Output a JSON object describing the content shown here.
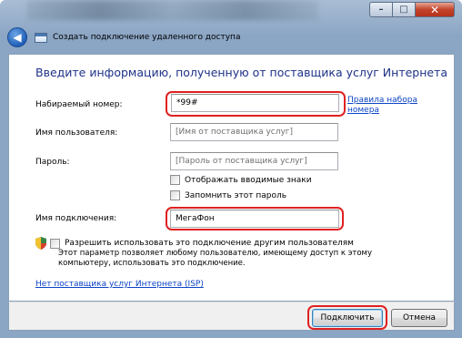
{
  "window": {
    "title": "Создать подключение удаленного доступа",
    "minimize_glyph": "–",
    "maximize_glyph": "□",
    "close_glyph": "✕"
  },
  "main": {
    "heading": "Введите информацию, полученную от поставщика услуг Интернета",
    "phone": {
      "label": "Набираемый номер:",
      "value": "*99#",
      "rules_link": "Правила набора номера"
    },
    "username": {
      "label": "Имя пользователя:",
      "placeholder": "[Имя от поставщика услуг]"
    },
    "password": {
      "label": "Пароль:",
      "placeholder": "[Пароль от поставщика услуг]"
    },
    "show_chars": {
      "label": "Отображать вводимые знаки",
      "checked": false
    },
    "remember_password": {
      "label": "Запомнить этот пароль",
      "checked": false
    },
    "connection_name": {
      "label": "Имя подключения:",
      "value": "МегаФон"
    },
    "allow_others": {
      "label": "Разрешить использовать это подключение другим пользователям",
      "checked": false,
      "description": "Этот параметр позволяет любому пользователю, имеющему доступ к этому компьютеру, использовать это подключение."
    },
    "no_isp_link": "Нет поставщика услуг Интернета (ISP)"
  },
  "footer": {
    "connect_label": "Подключить",
    "cancel_label": "Отмена"
  },
  "colors": {
    "heading": "#1e3287",
    "link": "#0b44c4",
    "highlight": "#e02020"
  }
}
